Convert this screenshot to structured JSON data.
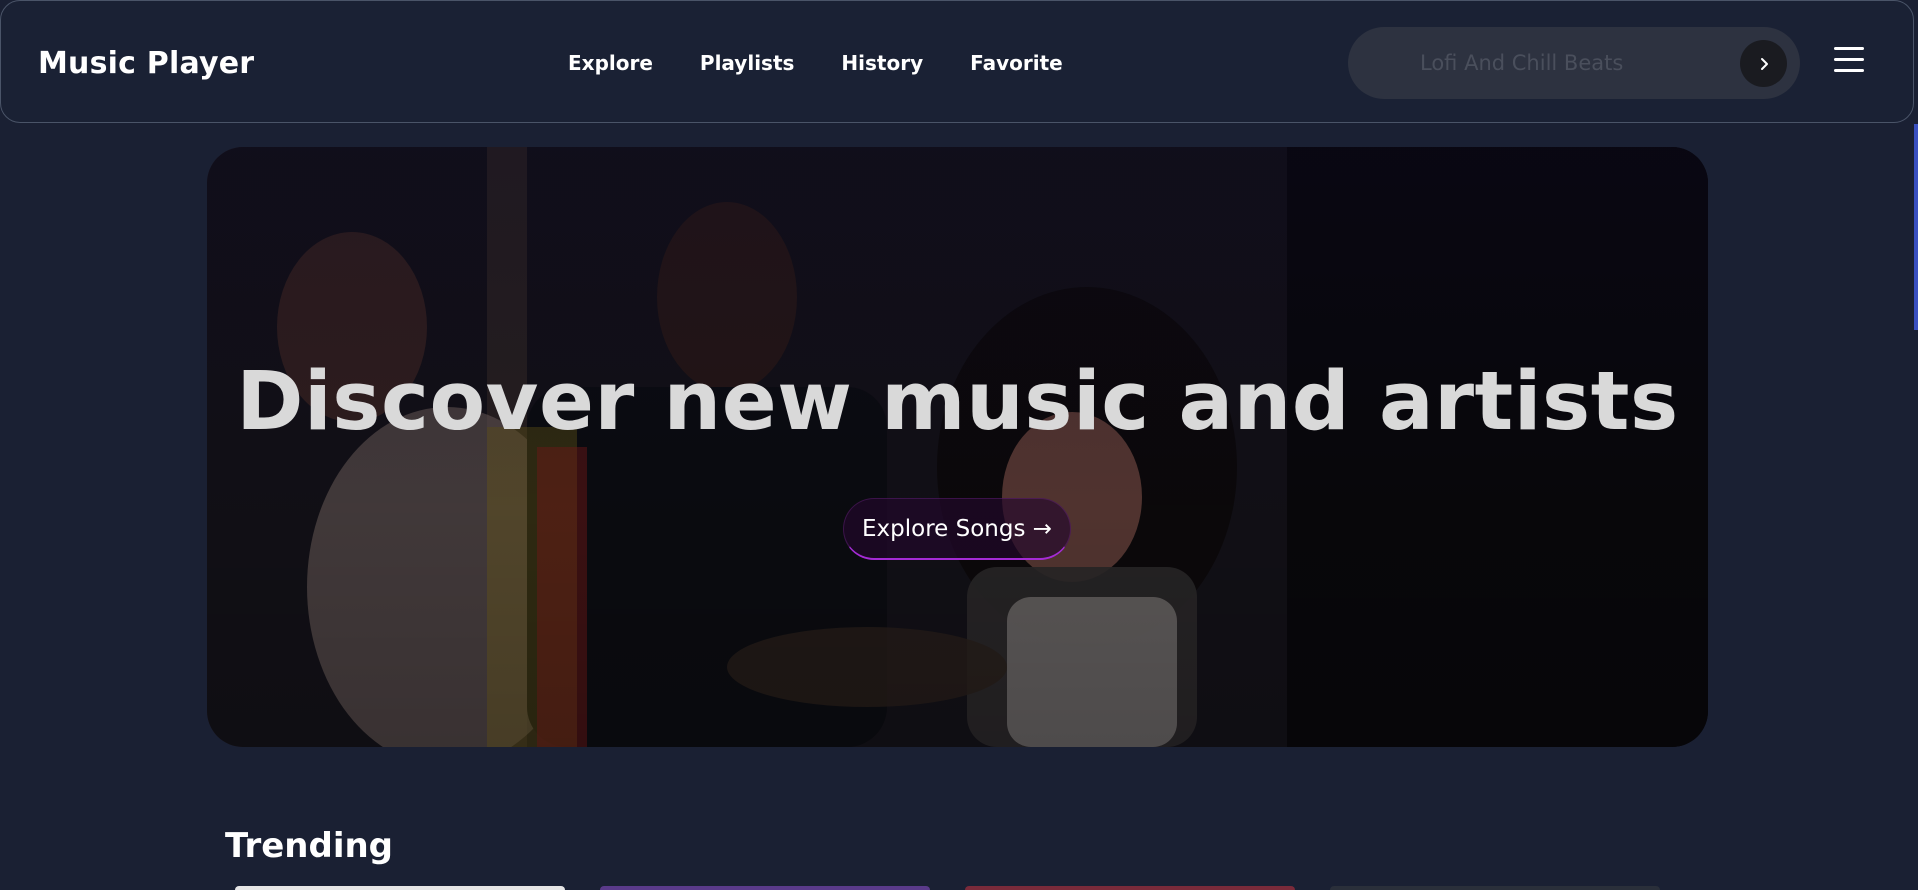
{
  "header": {
    "brand": "Music Player",
    "nav": [
      {
        "label": "Explore"
      },
      {
        "label": "Playlists"
      },
      {
        "label": "History"
      },
      {
        "label": "Favorite"
      }
    ],
    "search": {
      "placeholder": "Lofi And Chill Beats",
      "submit_icon": "chevron-right-icon"
    },
    "menu_icon": "hamburger-menu-icon"
  },
  "hero": {
    "title": "Discover new music and artists",
    "cta_label": "Explore Songs →"
  },
  "trending": {
    "title": "Trending"
  },
  "colors": {
    "background": "#1a2033",
    "navbar": "#1a2134",
    "search_bg": "#2d3240",
    "accent_purple": "#a52bd6",
    "scroll_thumb": "#3a50c0"
  }
}
